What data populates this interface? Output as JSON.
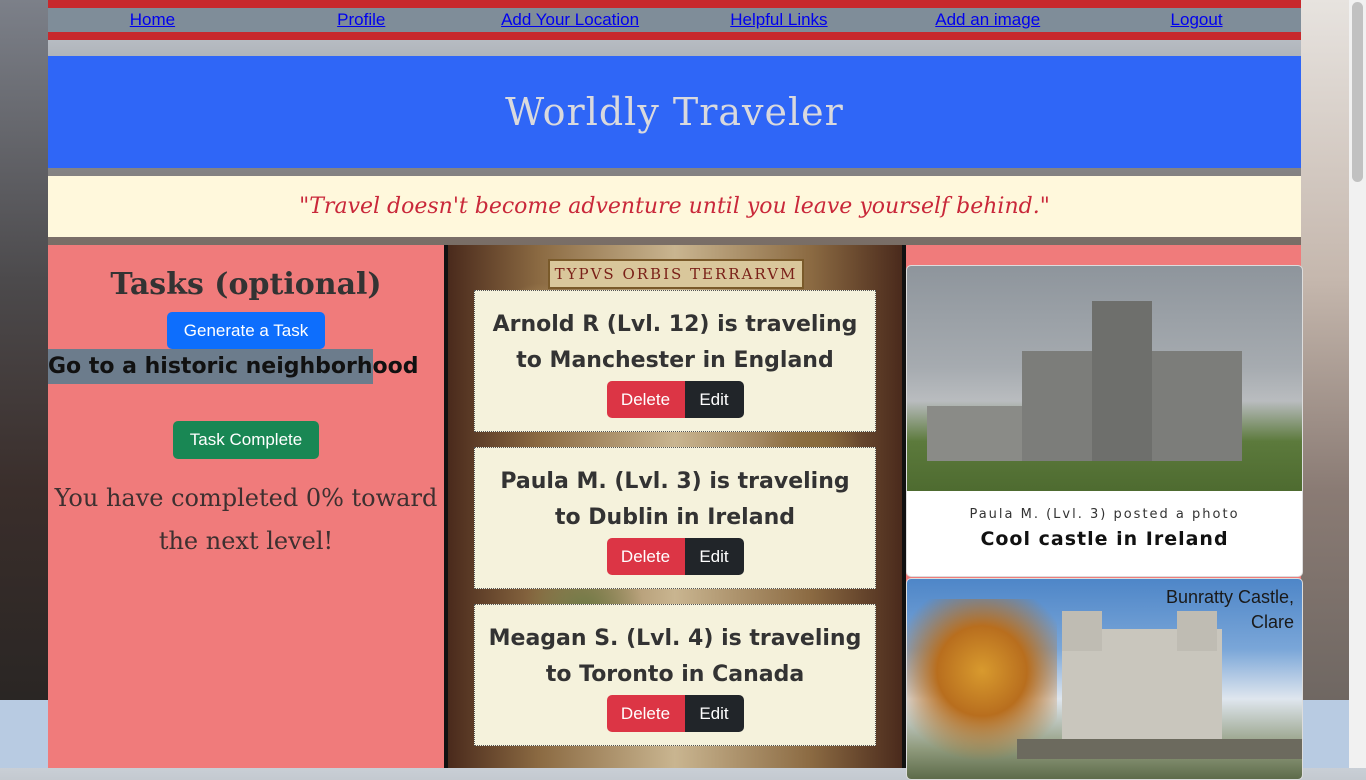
{
  "nav": {
    "items": [
      "Home",
      "Profile",
      "Add Your Location",
      "Helpful Links",
      "Add an image",
      "Logout"
    ]
  },
  "header": {
    "title": "Worldly Traveler",
    "quote": "\"Travel doesn't become adventure until you leave yourself behind.\""
  },
  "tasks": {
    "heading": "Tasks (optional)",
    "generate_label": "Generate a Task",
    "current_task": "Go to a historic neighborhood",
    "complete_label": "Task Complete",
    "progress_text": "You have completed 0% toward the next level!"
  },
  "map": {
    "title": "TYPVS ORBIS TERRARVM"
  },
  "travelers": [
    {
      "text": "Arnold R (Lvl. 12) is traveling to Manchester in England",
      "delete_label": "Delete",
      "edit_label": "Edit"
    },
    {
      "text": "Paula M. (Lvl. 3) is traveling to Dublin in Ireland",
      "delete_label": "Delete",
      "edit_label": "Edit"
    },
    {
      "text": "Meagan S. (Lvl. 4) is traveling to Toronto in Canada",
      "delete_label": "Delete",
      "edit_label": "Edit"
    }
  ],
  "posts": [
    {
      "meta": "Paula M. (Lvl. 3) posted a photo",
      "title": "Cool castle in Ireland"
    },
    {
      "caption_line1": "Bunratty Castle,",
      "caption_line2": "Clare"
    }
  ],
  "colors": {
    "nav_bar": "#c8282c",
    "banner": "#2f66f7",
    "panel": "#f07b7b",
    "quote_text": "#c9283a"
  }
}
